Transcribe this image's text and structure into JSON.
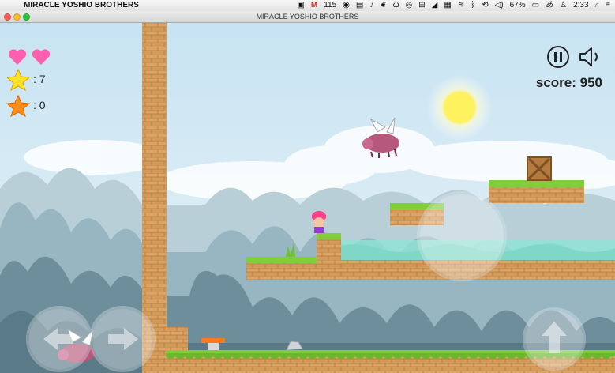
{
  "menubar": {
    "app_name": "MIRACLE YOSHIO BROTHERS",
    "gmail_count": "115",
    "battery": "67%",
    "input_method": "あ",
    "time": "2:33"
  },
  "window": {
    "title": "MIRACLE YOSHIO BROTHERS"
  },
  "hud": {
    "lives": 2,
    "stars_yellow": ": 7",
    "stars_orange": ": 0",
    "score_label": "score:",
    "score_value": "950"
  },
  "colors": {
    "sky": "#cfe6f2",
    "grass": "#7fce3a",
    "brick": "#d49a5b",
    "heart": "#ff5fae",
    "star_yellow": "#ffe12a",
    "star_orange": "#ff8c1a"
  }
}
